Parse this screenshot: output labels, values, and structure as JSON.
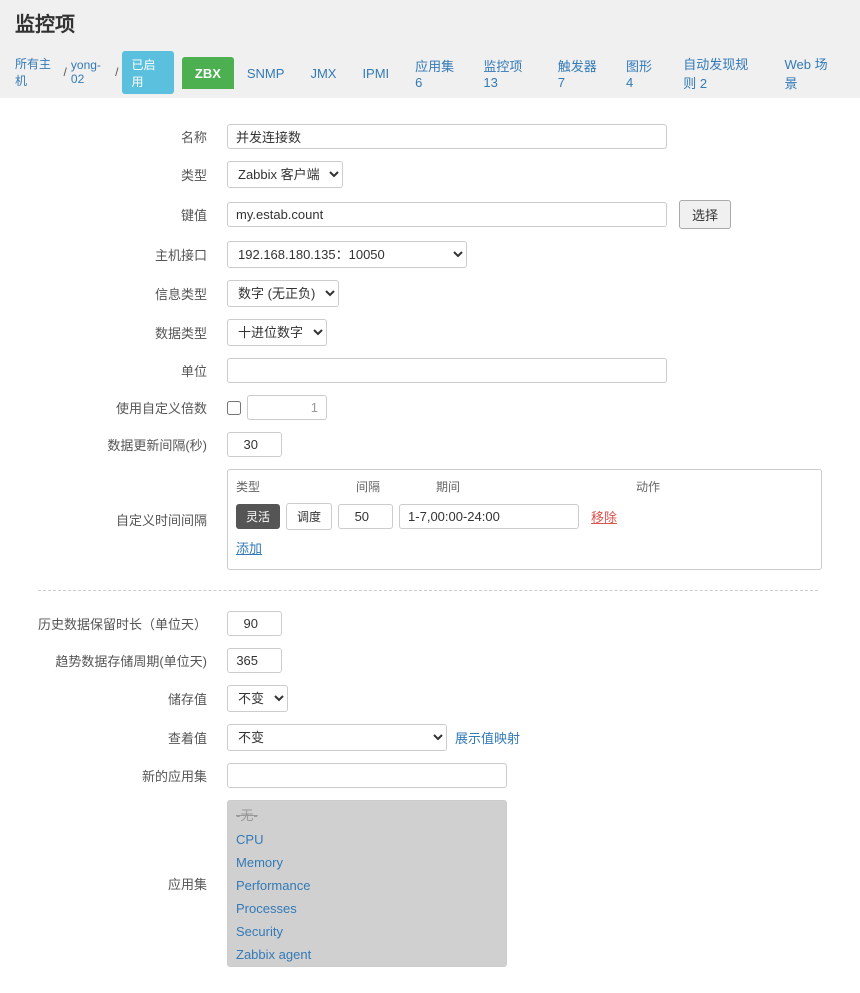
{
  "page": {
    "title": "监控项"
  },
  "breadcrumb": {
    "all_hosts": "所有主机",
    "separator": "/",
    "host": "yong-02"
  },
  "status_badge": "已启用",
  "tabs": [
    {
      "label": "ZBX",
      "key": "zbx",
      "active": true
    },
    {
      "label": "SNMP",
      "key": "snmp"
    },
    {
      "label": "JMX",
      "key": "jmx"
    },
    {
      "label": "IPMI",
      "key": "ipmi"
    },
    {
      "label": "应用集 6",
      "key": "appset"
    },
    {
      "label": "监控项 13",
      "key": "items"
    },
    {
      "label": "触发器 7",
      "key": "triggers"
    },
    {
      "label": "图形 4",
      "key": "graphs"
    },
    {
      "label": "自动发现规则 2",
      "key": "discovery"
    },
    {
      "label": "Web 场景",
      "key": "web"
    }
  ],
  "form": {
    "name_label": "名称",
    "name_value": "并发连接数",
    "type_label": "类型",
    "type_value": "Zabbix 客户端",
    "key_label": "键值",
    "key_value": "my.estab.count",
    "key_select_btn": "选择",
    "interface_label": "主机接口",
    "interface_value": "192.168.180.135：10050",
    "info_type_label": "信息类型",
    "info_type_value": "数字 (无正负)",
    "data_type_label": "数据类型",
    "data_type_value": "十进位数字",
    "unit_label": "单位",
    "unit_value": "",
    "custom_multi_label": "使用自定义倍数",
    "custom_multi_value": "1",
    "interval_label": "数据更新间隔(秒)",
    "interval_value": "30",
    "custom_time_label": "自定义时间间隔",
    "ci_col_type": "类型",
    "ci_col_interval": "间隔",
    "ci_col_period": "期间",
    "ci_col_action": "动作",
    "ci_flexible": "灵活",
    "ci_schedule": "调度",
    "ci_interval_value": "50",
    "ci_period_value": "1-7,00:00-24:00",
    "ci_remove": "移除",
    "ci_add": "添加",
    "history_label": "历史数据保留时长（单位天）",
    "history_value": "90",
    "trend_label": "趋势数据存储周期(单位天)",
    "trend_value": "365",
    "store_label": "储存值",
    "store_value": "不变",
    "show_label": "查着值",
    "show_value": "不变",
    "show_mapping_link": "展示值映射",
    "new_appset_label": "新的应用集",
    "new_appset_placeholder": "",
    "appset_label": "应用集",
    "appset_items": [
      {
        "label": "-无-",
        "style": "normal"
      },
      {
        "label": "CPU",
        "style": "colored"
      },
      {
        "label": "Memory",
        "style": "colored"
      },
      {
        "label": "Performance",
        "style": "colored"
      },
      {
        "label": "Processes",
        "style": "colored"
      },
      {
        "label": "Security",
        "style": "colored"
      },
      {
        "label": "Zabbix agent",
        "style": "colored"
      }
    ]
  }
}
